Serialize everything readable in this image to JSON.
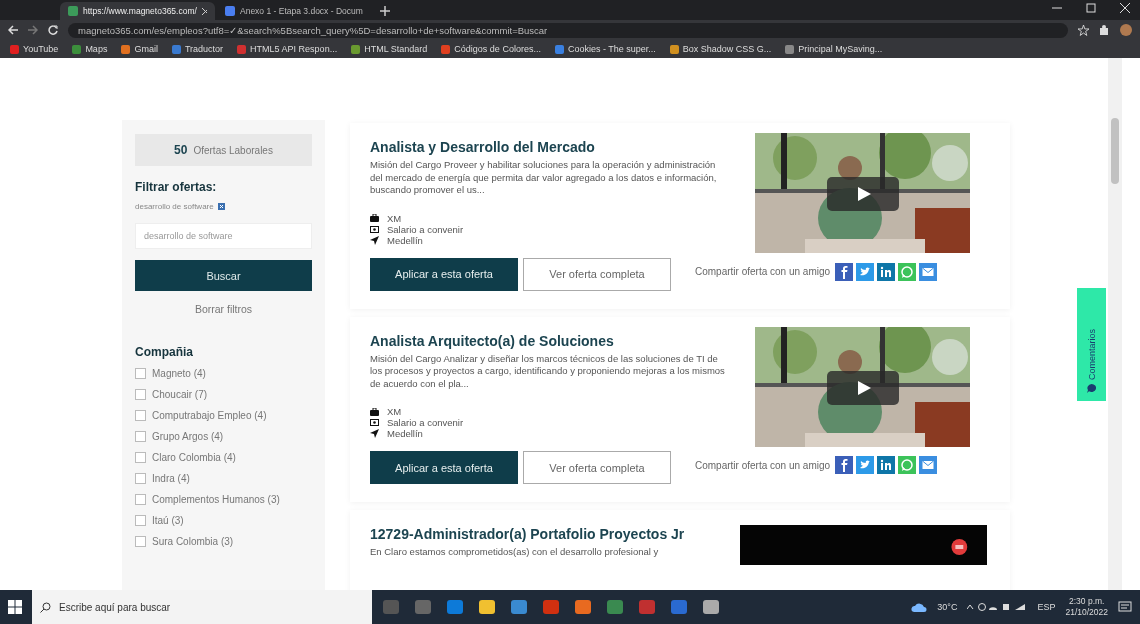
{
  "browser": {
    "tabs": [
      {
        "title": "https://www.magneto365.com/",
        "selected": true
      },
      {
        "title": "Anexo 1 - Etapa 3.docx - Docum",
        "selected": false
      }
    ],
    "address": "magneto365.com/es/empleos?utf8=✓&search%5Bsearch_query%5D=desarrollo+de+software&commit=Buscar",
    "bookmarks": [
      "YouTube",
      "Maps",
      "Gmail",
      "Traductor",
      "HTML5 API Respon...",
      "HTML Standard",
      "Códigos de Colores...",
      "Cookies - The super...",
      "Box Shadow CSS G...",
      "Principal MySaving..."
    ]
  },
  "sidebar": {
    "count": "50",
    "count_label": "Ofertas Laborales",
    "filter_title": "Filtrar ofertas:",
    "active_filter": "desarrollo de software",
    "search": {
      "value": "desarrollo de software"
    },
    "search_button": "Buscar",
    "clear_label": "Borrar filtros",
    "company_title": "Compañia",
    "companies": [
      {
        "label": "Magneto (4)",
        "checked": false
      },
      {
        "label": "Choucair (7)",
        "checked": false
      },
      {
        "label": "Computrabajo Empleo (4)",
        "checked": false
      },
      {
        "label": "Grupo Argos (4)",
        "checked": false
      },
      {
        "label": "Claro Colombia (4)",
        "checked": false
      },
      {
        "label": "Indra (4)",
        "checked": false
      },
      {
        "label": "Complementos Humanos (3)",
        "checked": false
      },
      {
        "label": "Itaú (3)",
        "checked": false
      },
      {
        "label": "Sura Colombia (3)",
        "checked": false
      }
    ]
  },
  "jobs": [
    {
      "title": "Analista y Desarrollo del Mercado",
      "description": "Misión del Cargo Proveer y habilitar soluciones para la operación y administración del mercado de energía que permita dar valor agregado a los datos e información, buscando promover el us...",
      "company": "XM",
      "salary": "Salario a convenir",
      "location": "Medellín",
      "apply": "Aplicar a esta oferta",
      "view": "Ver oferta completa",
      "share": "Compartir oferta con un amigo"
    },
    {
      "title": "Analista Arquitecto(a) de Soluciones",
      "description": "Misión del Cargo Analizar y diseñar los marcos técnicos de las soluciones de TI de los procesos y proyectos a cargo, identificando y proponiendo mejoras a los mismos de acuerdo con el pla...",
      "company": "XM",
      "salary": "Salario a convenir",
      "location": "Medellín",
      "apply": "Aplicar a esta oferta",
      "view": "Ver oferta completa",
      "share": "Compartir oferta con un amigo"
    },
    {
      "title": "12729-Administrador(a) Portafolio Proyectos Jr",
      "description": "En Claro estamos comprometidos(as) con el desarrollo profesional y",
      "media": {
        "kind": "dark"
      }
    }
  ],
  "feedback": "Comentarios",
  "taskbar": {
    "search_placeholder": "Escribe aquí para buscar",
    "weather": "30°C",
    "language": "ESP",
    "time": "2:30 p.m.",
    "date": "21/10/2022"
  }
}
